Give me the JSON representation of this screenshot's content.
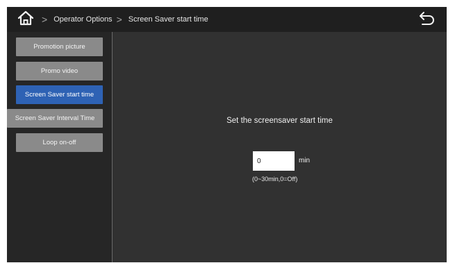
{
  "topbar": {
    "home_icon": "home-icon",
    "breadcrumb": [
      "Operator Options",
      "Screen Saver start time"
    ],
    "separator": ">",
    "back_icon": "back-arrow-icon"
  },
  "sidebar": {
    "items": [
      {
        "label": "Promotion picture",
        "active": false
      },
      {
        "label": "Promo video",
        "active": false
      },
      {
        "label": "Screen Saver start time",
        "active": true
      },
      {
        "label": "Screen Saver Interval Time",
        "active": false
      },
      {
        "label": "Loop on-off",
        "active": false
      }
    ]
  },
  "main": {
    "title": "Set the screensaver start time",
    "input_value": "0",
    "unit": "min",
    "hint": "(0~30min,0=Off)"
  },
  "colors": {
    "topbar_bg": "#1f1f1f",
    "sidebar_bg": "#262626",
    "content_bg": "#313131",
    "button_bg": "#8a8a8a",
    "active_bg": "#2e62b4"
  }
}
